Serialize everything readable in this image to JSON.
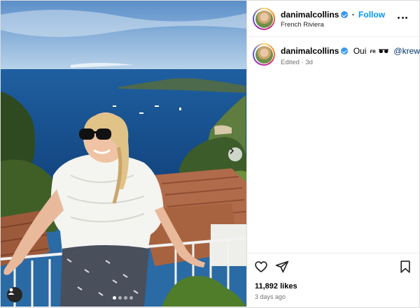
{
  "post": {
    "username": "danimalcollins",
    "follow_label": "Follow",
    "location": "French Riviera",
    "caption": {
      "text": "Oui",
      "flag": "FR",
      "mention": "@krewe",
      "meta": "Edited · 3d"
    },
    "likes": "11,892 likes",
    "posted_ago": "3 days ago",
    "carousel": {
      "total": 4,
      "current": 1
    }
  },
  "icons": {
    "verified": "verified-badge-icon",
    "more": "more-options-icon",
    "next": "chevron-right-icon",
    "user_tag": "user-tag-icon",
    "like": "heart-icon",
    "share": "paper-plane-icon",
    "save": "bookmark-icon"
  },
  "colors": {
    "accent": "#0095f6",
    "verified": "#3897f0",
    "mention": "#00376b",
    "muted": "#737373"
  }
}
